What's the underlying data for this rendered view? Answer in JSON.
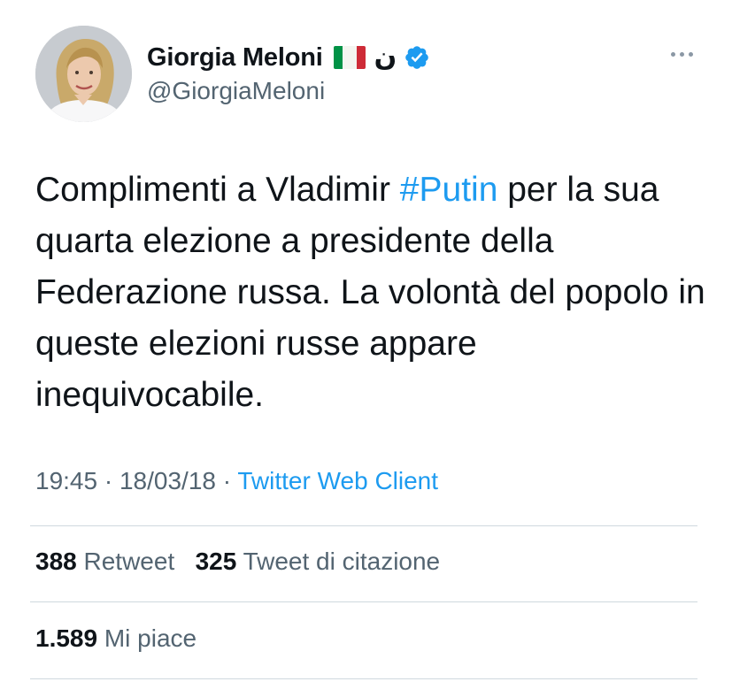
{
  "author": {
    "display_name": "Giorgia Meloni",
    "flag": "Italian flag",
    "extra_glyph": "ن",
    "verified": true,
    "handle": "@GiorgiaMeloni"
  },
  "tweet": {
    "text_before": "Complimenti a Vladimir ",
    "hashtag": "#Putin",
    "text_after": " per la sua quarta elezione a presidente della Federazione russa. La volontà del popolo in queste elezioni russe appare inequivocabile."
  },
  "meta": {
    "time": "19:45",
    "separator": "·",
    "date": "18/03/18",
    "source": "Twitter Web Client"
  },
  "stats": {
    "retweets_count": "388",
    "retweets_label": "Retweet",
    "quotes_count": "325",
    "quotes_label": "Tweet di citazione",
    "likes_count": "1.589",
    "likes_label": "Mi piace"
  },
  "colors": {
    "accent": "#1d9bf0",
    "text": "#0f1419",
    "secondary_text": "#536471",
    "divider": "#cfd9de"
  },
  "icons": {
    "more": "more-horizontal-icon",
    "verified": "verified-badge-icon"
  }
}
